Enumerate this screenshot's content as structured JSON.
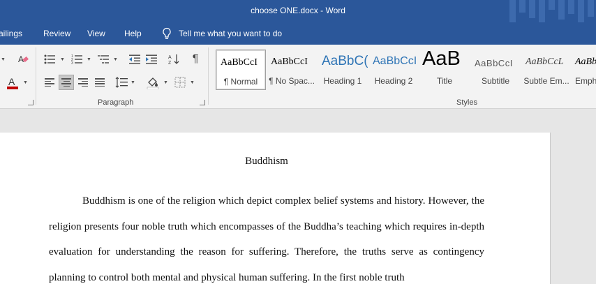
{
  "titlebar": {
    "title": "choose ONE.docx  -  Word"
  },
  "menu": {
    "tabs": [
      "ailings",
      "Review",
      "View",
      "Help"
    ],
    "tell_me": "Tell me what you want to do"
  },
  "ribbon": {
    "paragraph_label": "Paragraph",
    "styles_label": "Styles",
    "styles": [
      {
        "preview": "AaBbCcI",
        "label": "¶ Normal"
      },
      {
        "preview": "AaBbCcI",
        "label": "¶ No Spac..."
      },
      {
        "preview": "AaBbC(",
        "label": "Heading 1"
      },
      {
        "preview": "AaBbCcI",
        "label": "Heading 2"
      },
      {
        "preview": "AaB",
        "label": "Title"
      },
      {
        "preview": "AaBbCcI",
        "label": "Subtitle"
      },
      {
        "preview": "AaBbCcL",
        "label": "Subtle Em..."
      },
      {
        "preview": "AaBb",
        "label": "Emph"
      }
    ],
    "colors": {
      "font_color_bar": "#c00000",
      "ribbon_accent": "#2b579a",
      "heading_blue": "#2e74b5"
    }
  },
  "document": {
    "title": "Buddhism",
    "paragraph": "Buddhism is one of the religion which depict complex belief systems and history. However, the religion presents four noble truth which encompasses of the Buddha’s teaching which requires in-depth evaluation for understanding the reason for suffering. Therefore, the truths serve as contingency planning to control both mental and physical human suffering. In the first noble truth"
  }
}
